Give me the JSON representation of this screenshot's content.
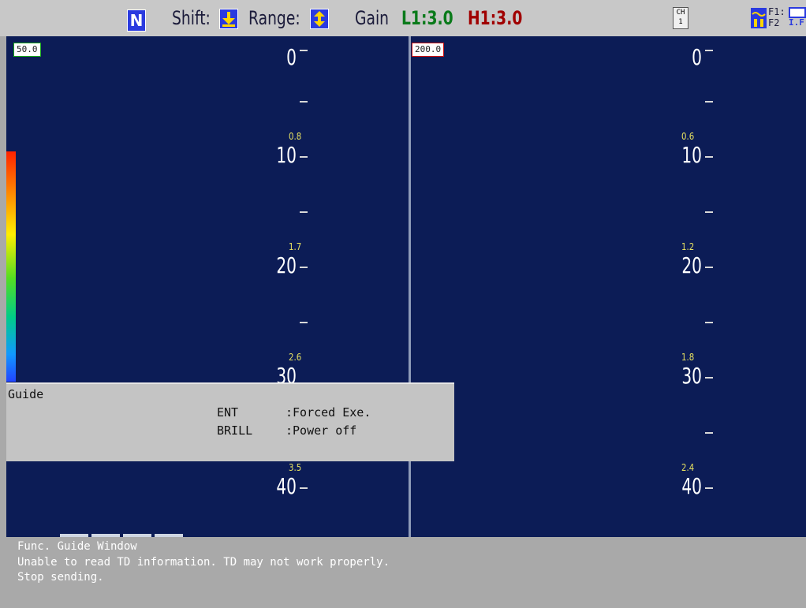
{
  "top_bar": {
    "mode": "N",
    "shift_label": "Shift:",
    "range_label": "Range:",
    "gain_label": "Gain",
    "gain_low": "L1:3.0",
    "gain_high": "H1:3.0",
    "channel_top": "CH",
    "channel_bottom": "1",
    "f1_label": "F1:",
    "f2_label": "F2",
    "f2_value": "I.F",
    "colors": {
      "gain_low": "#0a7a1a",
      "gain_high": "#a00000",
      "mode_box": "#2a3adf"
    }
  },
  "left_panel": {
    "range": "50.0",
    "depth_marks": [
      "0",
      "10",
      "20",
      "30",
      "40"
    ],
    "sub_values": [
      "0.8",
      "1.7",
      "2.6",
      "3.5"
    ]
  },
  "right_panel": {
    "range": "200.0",
    "depth_marks": [
      "0",
      "10",
      "20",
      "30",
      "40"
    ],
    "sub_values": [
      "0.6",
      "1.2",
      "1.8",
      "2.4"
    ]
  },
  "guide": {
    "title": "Guide",
    "rows": [
      {
        "key": "ENT",
        "desc": ":Forced Exe."
      },
      {
        "key": "BRILL",
        "desc": ":Power off"
      }
    ]
  },
  "message": {
    "title": "Func. Guide Window",
    "line1": "Unable to read TD information. TD may not work properly.",
    "line2": "Stop sending."
  }
}
